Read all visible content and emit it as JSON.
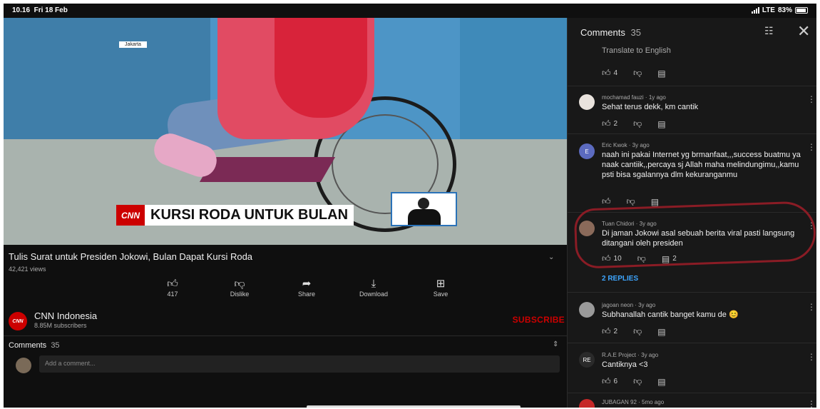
{
  "status": {
    "time": "10.16",
    "date": "Fri 18 Feb",
    "network": "LTE",
    "battery": "83%"
  },
  "video": {
    "location_label": "Jakarta",
    "network_bug": "CNN",
    "headline": "KURSI RODA UNTUK BULAN",
    "title": "Tulis Surat untuk Presiden Jokowi, Bulan Dapat Kursi Roda",
    "views": "42,421 views"
  },
  "actions": [
    {
      "icon": "like-icon",
      "label": "417"
    },
    {
      "icon": "dislike-icon",
      "label": "Dislike"
    },
    {
      "icon": "share-icon",
      "label": "Share"
    },
    {
      "icon": "download-icon",
      "label": "Download"
    },
    {
      "icon": "save-icon",
      "label": "Save"
    }
  ],
  "channel": {
    "name": "CNN Indonesia",
    "subscribers": "8.85M subscribers",
    "subscribe_label": "SUBSCRIBE",
    "logo_text": "CNN"
  },
  "lower_comments": {
    "title": "Comments",
    "count": "35",
    "placeholder": "Add a comment..."
  },
  "panel": {
    "title": "Comments",
    "count": "35",
    "translate_label": "Translate to English",
    "first_likes": "4",
    "comments": [
      {
        "author": "mochamad fauzi",
        "age": "1y ago",
        "text": "Sehat terus dekk, km cantik",
        "likes": "2",
        "replies": "",
        "avatar_color": "#e9e3dd",
        "avatar_text": ""
      },
      {
        "author": "Eric Kwok",
        "age": "3y ago",
        "text": "naah ini pakai Internet yg brmanfaat,,,success buatmu ya naak cantiik,,percaya sj Allah maha melindungimu,,kamu psti bisa sgalannya dlm kekuranganmu",
        "likes": "",
        "replies": "",
        "avatar_color": "#5c6bc0",
        "avatar_text": "E"
      },
      {
        "author": "Tuan Chidori",
        "age": "3y ago",
        "text": "Di jaman Jokowi asal sebuah berita viral pasti langsung ditangani oleh presiden",
        "likes": "10",
        "replies": "2",
        "avatar_color": "#8a6a5a",
        "avatar_text": ""
      },
      {
        "author": "jagoan neon",
        "age": "3y ago",
        "text": "Subhanallah cantik banget kamu de 😊",
        "likes": "2",
        "replies": "",
        "avatar_color": "#9a9a9a",
        "avatar_text": ""
      },
      {
        "author": "R.A.E Project",
        "age": "3y ago",
        "text": "Cantiknya <3",
        "likes": "6",
        "replies": "",
        "avatar_color": "#2a2a2a",
        "avatar_text": "RE"
      },
      {
        "author": "JUBAGAN 92",
        "age": "5mo ago",
        "text": "",
        "likes": "",
        "replies": "",
        "avatar_color": "#c62828",
        "avatar_text": ""
      }
    ],
    "replies_label": "2 REPLIES"
  },
  "colors": {
    "accent_red": "#cc0000",
    "link_blue": "#3ea6ff",
    "background": "#0f0f0f",
    "panel_bg": "#181818"
  }
}
